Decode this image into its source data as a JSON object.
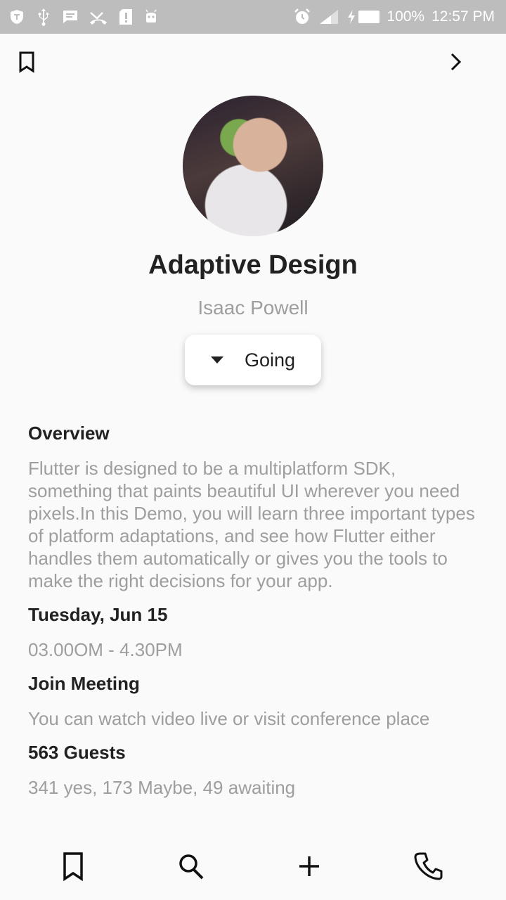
{
  "status_bar": {
    "battery": "100%",
    "time": "12:57 PM",
    "left_icons": [
      "shield-icon",
      "usb-icon",
      "message-icon",
      "missed-call-icon",
      "alert-card-icon",
      "android-icon"
    ],
    "right_icons": [
      "alarm-icon",
      "signal-icon",
      "charging-icon",
      "battery-icon"
    ]
  },
  "header": {
    "left_icon": "bookmark-icon",
    "right_icon": "chevron-right-icon"
  },
  "event": {
    "title": "Adaptive Design",
    "host": "Isaac Powell",
    "rsvp_label": "Going"
  },
  "sections": {
    "overview_title": "Overview",
    "overview_text": "Flutter is designed to be a multiplatform SDK, something that paints beautiful UI wherever you need pixels.In this Demo, you will learn three important types of platform adaptations, and see how Flutter either handles them automatically or gives you the tools to make the right decisions for your app.",
    "date_title": "Tuesday, Jun 15",
    "date_text": "03.00OM - 4.30PM",
    "meeting_title": "Join Meeting",
    "meeting_text": "You can watch video live or visit conference place",
    "guests_title": "563 Guests",
    "guests_text": "341 yes, 173 Maybe, 49 awaiting"
  },
  "bottom_nav": {
    "items": [
      "bookmark-icon",
      "search-icon",
      "add-icon",
      "phone-icon"
    ]
  },
  "colors": {
    "background": "#fafafa",
    "status_bar": "#bdbdbd",
    "primary_text": "#212121",
    "secondary_text": "#9e9e9e"
  }
}
